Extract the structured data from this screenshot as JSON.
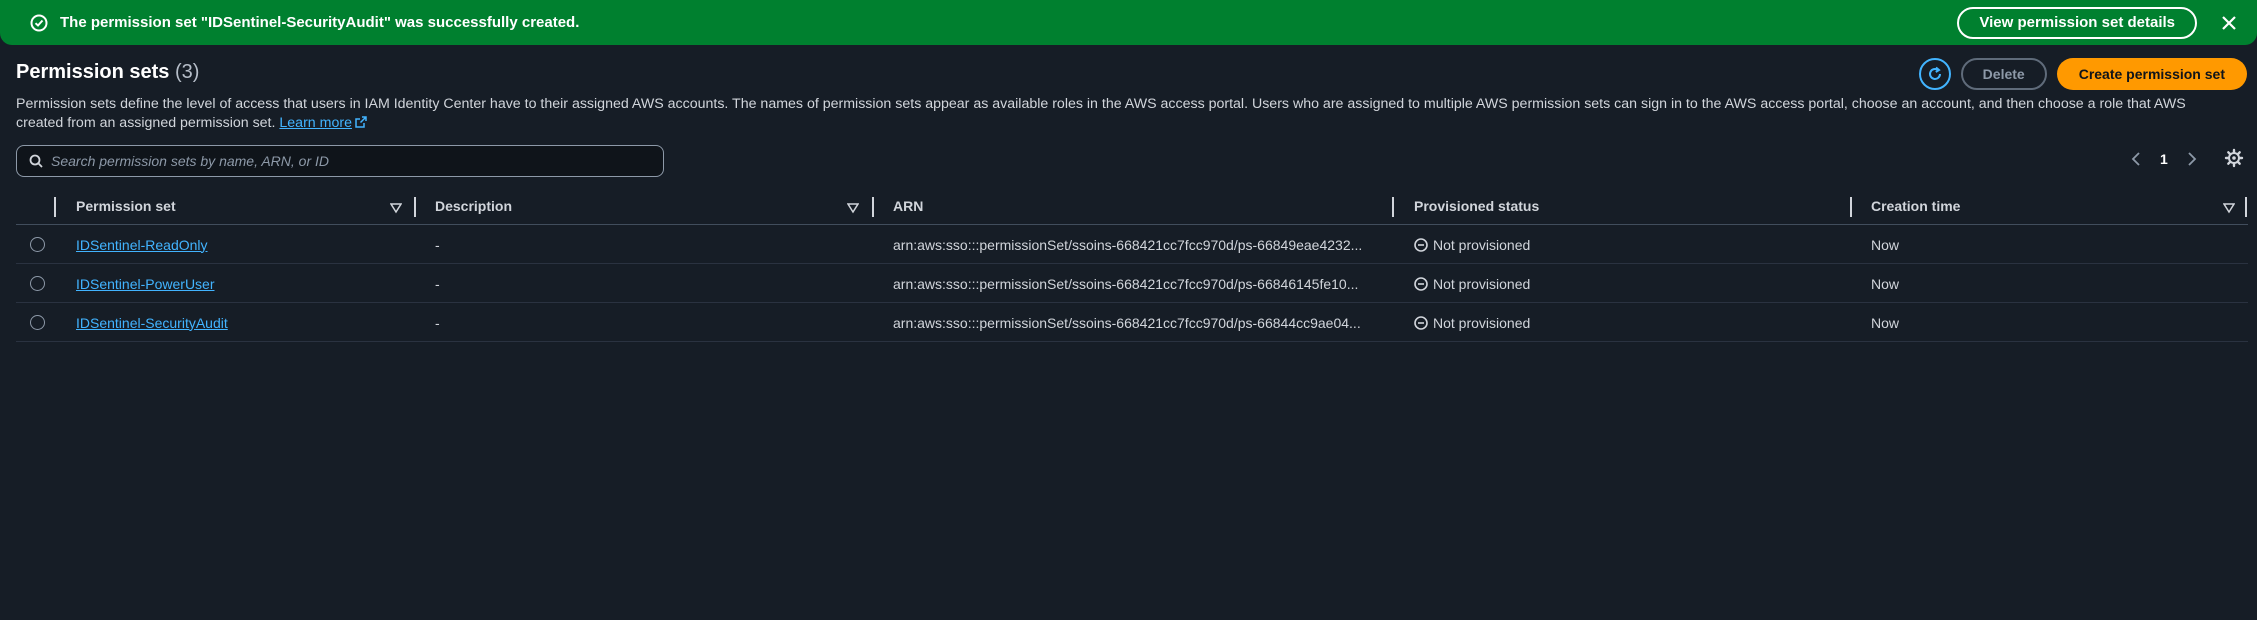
{
  "flash": {
    "message": "The permission set \"IDSentinel-SecurityAudit\" was successfully created.",
    "view_button": "View permission set details",
    "icons": {
      "status": "check-circle-icon",
      "dismiss": "close-icon"
    },
    "color": "#00802f"
  },
  "header": {
    "title": "Permission sets",
    "count": "(3)",
    "delete_label": "Delete",
    "create_label": "Create permission set",
    "accent_color": "#ff9900"
  },
  "description": {
    "text": "Permission sets define the level of access that users in IAM Identity Center have to their assigned AWS accounts. The names of permission sets appear as available roles in the AWS access portal. Users who are assigned to multiple AWS permission sets can sign in to the AWS access portal, choose an account, and then choose a role that AWS created from an assigned permission set.",
    "learn_more": "Learn more"
  },
  "search": {
    "placeholder": "Search permission sets by name, ARN, or ID",
    "value": ""
  },
  "pagination": {
    "current_page": "1"
  },
  "table": {
    "columns": [
      "Permission set",
      "Description",
      "ARN",
      "Provisioned status",
      "Creation time"
    ],
    "rows": [
      {
        "name": "IDSentinel-ReadOnly",
        "description": "-",
        "arn": "arn:aws:sso:::permissionSet/ssoins-668421cc7fcc970d/ps-66849eae4232...",
        "status": "Not provisioned",
        "created": "Now"
      },
      {
        "name": "IDSentinel-PowerUser",
        "description": "-",
        "arn": "arn:aws:sso:::permissionSet/ssoins-668421cc7fcc970d/ps-66846145fe10...",
        "status": "Not provisioned",
        "created": "Now"
      },
      {
        "name": "IDSentinel-SecurityAudit",
        "description": "-",
        "arn": "arn:aws:sso:::permissionSet/ssoins-668421cc7fcc970d/ps-66844cc9ae04...",
        "status": "Not provisioned",
        "created": "Now"
      }
    ]
  }
}
